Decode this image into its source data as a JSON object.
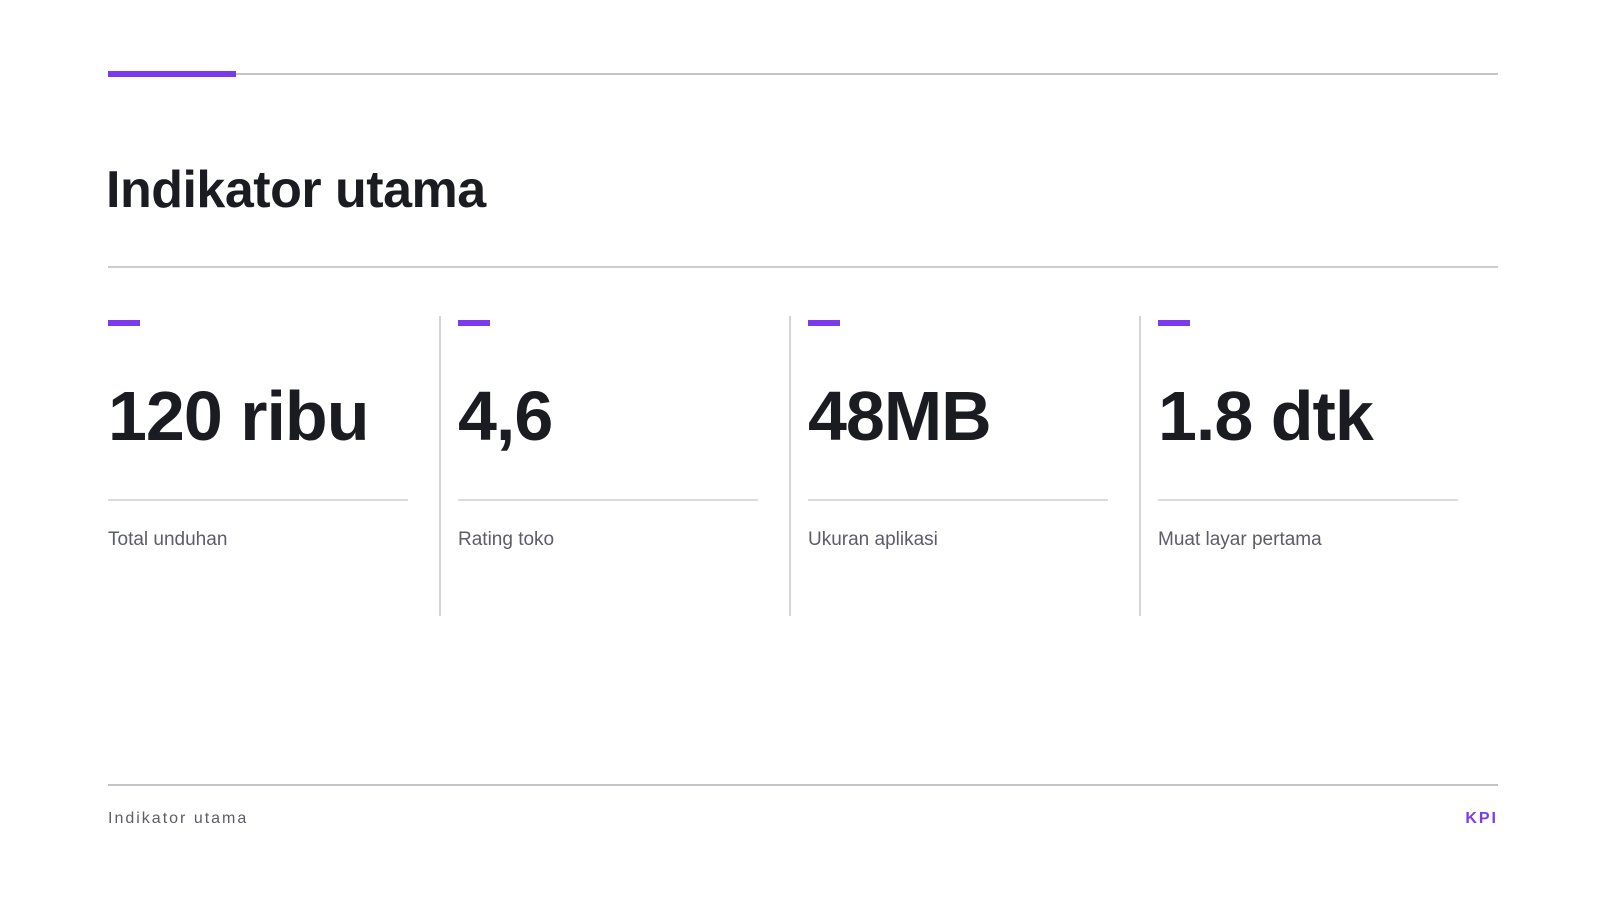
{
  "slide": {
    "title": "Indikator utama",
    "accent_color": "#7c3aed"
  },
  "kpis": [
    {
      "value": "120 ribu",
      "label": "Total unduhan"
    },
    {
      "value": "4,6",
      "label": "Rating toko"
    },
    {
      "value": "48MB",
      "label": "Ukuran aplikasi"
    },
    {
      "value": "1.8 dtk",
      "label": "Muat layar pertama"
    }
  ],
  "footer": {
    "section": "Indikator utama",
    "tag": "KPI"
  }
}
